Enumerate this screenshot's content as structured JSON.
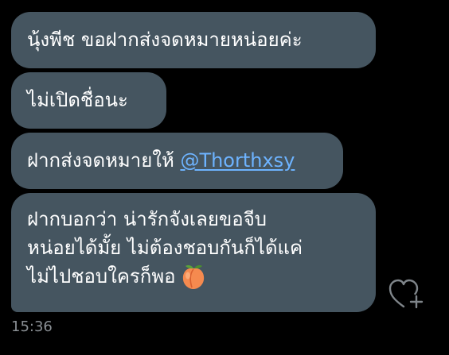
{
  "messages": [
    {
      "text": "นุ้งพีช ขอฝากส่งจดหมายหน่อยค่ะ"
    },
    {
      "text": "ไม่เปิดชื่อนะ"
    },
    {
      "text_prefix": "ฝากส่งจดหมายให้ ",
      "mention": "@Thorthxsy"
    },
    {
      "lines": [
        "ฝากบอกว่า น่ารักจังเลยขอจีบ",
        "หน่อยได้มั้ย ไม่ต้องชอบกันก็ได้แค่",
        "ไม่ไปชอบใครก็พอ"
      ],
      "emoji": "peach-icon"
    }
  ],
  "timestamp": "15:36",
  "reaction_button_icon": "heart-plus-icon",
  "colors": {
    "background": "#000000",
    "bubble": "#455560",
    "text": "#ffffff",
    "mention": "#6db3ff",
    "timestamp": "#8a8f94"
  }
}
